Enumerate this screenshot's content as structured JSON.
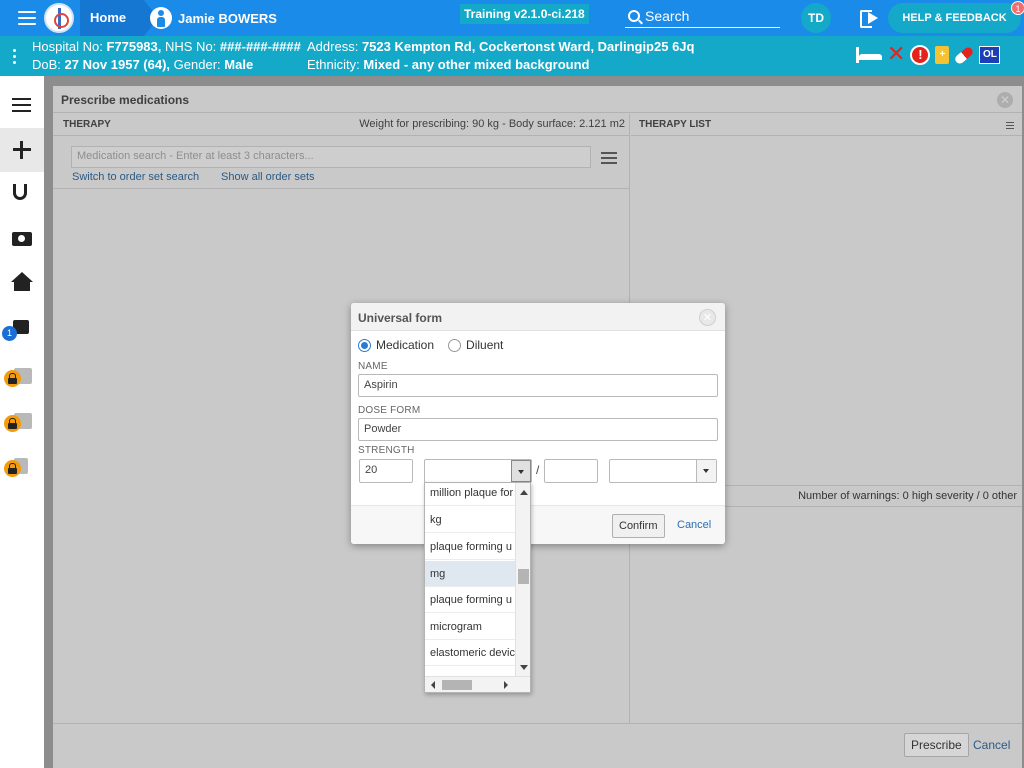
{
  "topbar": {
    "home_label": "Home",
    "patient_name": "Jamie BOWERS",
    "version": "Training v2.1.0-ci.218",
    "search_placeholder": "Search",
    "user_initials": "TD",
    "help_label": "HELP & FEEDBACK",
    "help_badge": "1",
    "bar_color": "#1a8be8",
    "accent_color": "#15a9c9",
    "icons": [
      "menu-icon",
      "app-logo-icon",
      "person-icon",
      "search-icon",
      "logout-icon"
    ]
  },
  "banner": {
    "hospital_label": "Hospital No:",
    "hospital_no": "F775983,",
    "nhs_label": "NHS No:",
    "nhs_no": "###-###-####",
    "address_label": "Address:",
    "address": "7523 Kempton Rd, Cockertonst Ward, Darlingip25 6Jq",
    "dob_label": "DoB:",
    "dob": "27 Nov 1957 (64),",
    "gender_label": "Gender:",
    "gender": "Male",
    "ethnicity_label": "Ethnicity:",
    "ethnicity": "Mixed - any other mixed background",
    "icons": [
      "bed-icon",
      "no-allergy-x-icon",
      "alert-icon",
      "clipboard-icon",
      "pill-icon",
      "ol-icon"
    ],
    "ol_text": "OL"
  },
  "sidebar": {
    "items": [
      {
        "icon": "list-icon"
      },
      {
        "icon": "plus-icon"
      },
      {
        "icon": "stethoscope-icon"
      },
      {
        "icon": "camera-icon"
      },
      {
        "icon": "home-icon"
      },
      {
        "icon": "edit-icon",
        "badge": "1"
      },
      {
        "icon": "documents-icon",
        "locked": true
      },
      {
        "icon": "walking-icon",
        "locked": true
      },
      {
        "icon": "add-icon",
        "locked": true
      }
    ]
  },
  "prescribe": {
    "title": "Prescribe medications",
    "therapy_caption": "THERAPY",
    "weight_info": "Weight for prescribing: 90 kg - Body surface: 2.121 m2",
    "search_placeholder": "Medication search - Enter at least 3 characters...",
    "link_order_set_search": "Switch to order set search",
    "link_show_order_sets": "Show all order sets",
    "therapy_list_caption": "THERAPY LIST",
    "warnings": "Number of warnings: 0 high severity / 0 other",
    "prescribe_label": "Prescribe",
    "cancel_label": "Cancel"
  },
  "modal": {
    "title": "Universal form",
    "radio_medication": "Medication",
    "radio_diluent": "Diluent",
    "selected_radio": "Medication",
    "name_label": "NAME",
    "name_value": "Aspirin",
    "dose_form_label": "DOSE FORM",
    "dose_form_value": "Powder",
    "strength_label": "STRENGTH",
    "strength_value": "20",
    "strength_unit_value": "",
    "strength_denominator": "",
    "denominator_unit_value": "",
    "slash": "/",
    "confirm_label": "Confirm",
    "cancel_label": "Cancel"
  },
  "unit_dropdown": {
    "options": [
      "million plaque for",
      "kg",
      "plaque forming u",
      "mg",
      "plaque forming u",
      "microgram",
      "elastomeric devic"
    ],
    "highlighted_index": 3
  }
}
